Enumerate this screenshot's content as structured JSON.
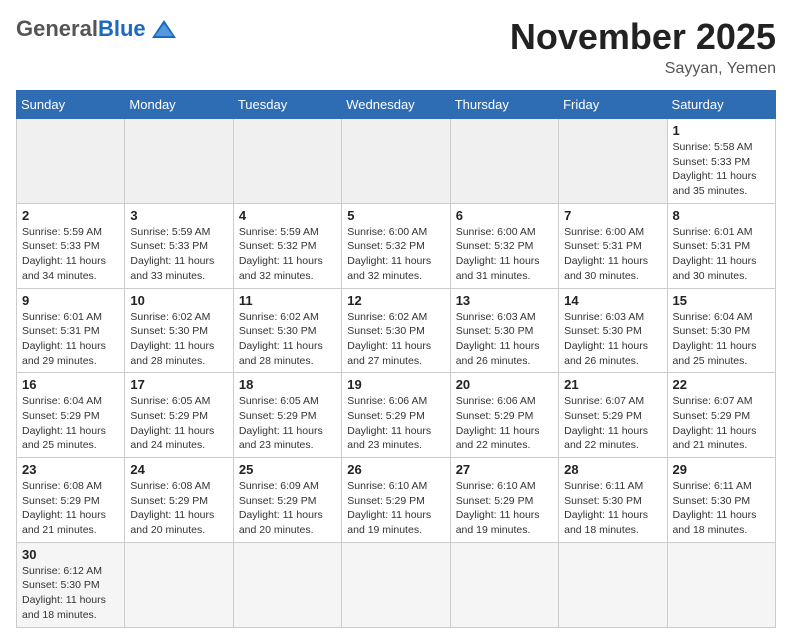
{
  "header": {
    "logo_general": "General",
    "logo_blue": "Blue",
    "month_title": "November 2025",
    "location": "Sayyan, Yemen"
  },
  "weekdays": [
    "Sunday",
    "Monday",
    "Tuesday",
    "Wednesday",
    "Thursday",
    "Friday",
    "Saturday"
  ],
  "weeks": [
    [
      {
        "day": null,
        "info": null
      },
      {
        "day": null,
        "info": null
      },
      {
        "day": null,
        "info": null
      },
      {
        "day": null,
        "info": null
      },
      {
        "day": null,
        "info": null
      },
      {
        "day": null,
        "info": null
      },
      {
        "day": "1",
        "info": "Sunrise: 5:58 AM\nSunset: 5:33 PM\nDaylight: 11 hours and 35 minutes."
      }
    ],
    [
      {
        "day": "2",
        "info": "Sunrise: 5:59 AM\nSunset: 5:33 PM\nDaylight: 11 hours and 34 minutes."
      },
      {
        "day": "3",
        "info": "Sunrise: 5:59 AM\nSunset: 5:33 PM\nDaylight: 11 hours and 33 minutes."
      },
      {
        "day": "4",
        "info": "Sunrise: 5:59 AM\nSunset: 5:32 PM\nDaylight: 11 hours and 32 minutes."
      },
      {
        "day": "5",
        "info": "Sunrise: 6:00 AM\nSunset: 5:32 PM\nDaylight: 11 hours and 32 minutes."
      },
      {
        "day": "6",
        "info": "Sunrise: 6:00 AM\nSunset: 5:32 PM\nDaylight: 11 hours and 31 minutes."
      },
      {
        "day": "7",
        "info": "Sunrise: 6:00 AM\nSunset: 5:31 PM\nDaylight: 11 hours and 30 minutes."
      },
      {
        "day": "8",
        "info": "Sunrise: 6:01 AM\nSunset: 5:31 PM\nDaylight: 11 hours and 30 minutes."
      }
    ],
    [
      {
        "day": "9",
        "info": "Sunrise: 6:01 AM\nSunset: 5:31 PM\nDaylight: 11 hours and 29 minutes."
      },
      {
        "day": "10",
        "info": "Sunrise: 6:02 AM\nSunset: 5:30 PM\nDaylight: 11 hours and 28 minutes."
      },
      {
        "day": "11",
        "info": "Sunrise: 6:02 AM\nSunset: 5:30 PM\nDaylight: 11 hours and 28 minutes."
      },
      {
        "day": "12",
        "info": "Sunrise: 6:02 AM\nSunset: 5:30 PM\nDaylight: 11 hours and 27 minutes."
      },
      {
        "day": "13",
        "info": "Sunrise: 6:03 AM\nSunset: 5:30 PM\nDaylight: 11 hours and 26 minutes."
      },
      {
        "day": "14",
        "info": "Sunrise: 6:03 AM\nSunset: 5:30 PM\nDaylight: 11 hours and 26 minutes."
      },
      {
        "day": "15",
        "info": "Sunrise: 6:04 AM\nSunset: 5:30 PM\nDaylight: 11 hours and 25 minutes."
      }
    ],
    [
      {
        "day": "16",
        "info": "Sunrise: 6:04 AM\nSunset: 5:29 PM\nDaylight: 11 hours and 25 minutes."
      },
      {
        "day": "17",
        "info": "Sunrise: 6:05 AM\nSunset: 5:29 PM\nDaylight: 11 hours and 24 minutes."
      },
      {
        "day": "18",
        "info": "Sunrise: 6:05 AM\nSunset: 5:29 PM\nDaylight: 11 hours and 23 minutes."
      },
      {
        "day": "19",
        "info": "Sunrise: 6:06 AM\nSunset: 5:29 PM\nDaylight: 11 hours and 23 minutes."
      },
      {
        "day": "20",
        "info": "Sunrise: 6:06 AM\nSunset: 5:29 PM\nDaylight: 11 hours and 22 minutes."
      },
      {
        "day": "21",
        "info": "Sunrise: 6:07 AM\nSunset: 5:29 PM\nDaylight: 11 hours and 22 minutes."
      },
      {
        "day": "22",
        "info": "Sunrise: 6:07 AM\nSunset: 5:29 PM\nDaylight: 11 hours and 21 minutes."
      }
    ],
    [
      {
        "day": "23",
        "info": "Sunrise: 6:08 AM\nSunset: 5:29 PM\nDaylight: 11 hours and 21 minutes."
      },
      {
        "day": "24",
        "info": "Sunrise: 6:08 AM\nSunset: 5:29 PM\nDaylight: 11 hours and 20 minutes."
      },
      {
        "day": "25",
        "info": "Sunrise: 6:09 AM\nSunset: 5:29 PM\nDaylight: 11 hours and 20 minutes."
      },
      {
        "day": "26",
        "info": "Sunrise: 6:10 AM\nSunset: 5:29 PM\nDaylight: 11 hours and 19 minutes."
      },
      {
        "day": "27",
        "info": "Sunrise: 6:10 AM\nSunset: 5:29 PM\nDaylight: 11 hours and 19 minutes."
      },
      {
        "day": "28",
        "info": "Sunrise: 6:11 AM\nSunset: 5:30 PM\nDaylight: 11 hours and 18 minutes."
      },
      {
        "day": "29",
        "info": "Sunrise: 6:11 AM\nSunset: 5:30 PM\nDaylight: 11 hours and 18 minutes."
      }
    ],
    [
      {
        "day": "30",
        "info": "Sunrise: 6:12 AM\nSunset: 5:30 PM\nDaylight: 11 hours and 18 minutes."
      },
      {
        "day": null,
        "info": null
      },
      {
        "day": null,
        "info": null
      },
      {
        "day": null,
        "info": null
      },
      {
        "day": null,
        "info": null
      },
      {
        "day": null,
        "info": null
      },
      {
        "day": null,
        "info": null
      }
    ]
  ]
}
